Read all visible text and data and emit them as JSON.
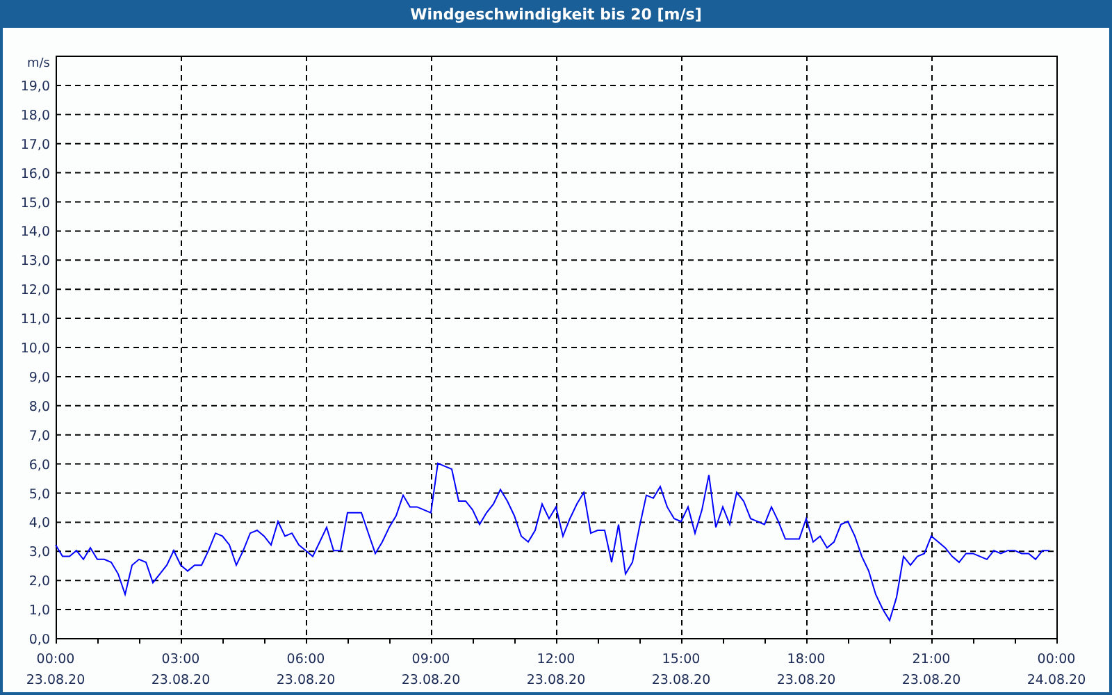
{
  "window": {
    "title": "Windgeschwindigkeit bis 20 [m/s]"
  },
  "chart_data": {
    "type": "line",
    "grid": true,
    "ylabel": "m/s",
    "ylim": [
      0,
      20
    ],
    "categories": [
      "00:00\n23.08.20",
      null,
      null,
      null,
      null,
      null,
      null,
      null,
      null,
      null,
      null,
      null,
      null,
      null,
      null,
      null,
      null,
      null,
      "03:00\n23.08.20",
      null,
      null,
      null,
      null,
      null,
      null,
      null,
      null,
      null,
      null,
      null,
      null,
      null,
      null,
      null,
      null,
      null,
      "06:00\n23.08.20",
      null,
      null,
      null,
      null,
      null,
      null,
      null,
      null,
      null,
      null,
      null,
      null,
      null,
      null,
      null,
      null,
      null,
      "09:00\n23.08.20",
      null,
      null,
      null,
      null,
      null,
      null,
      null,
      null,
      null,
      null,
      null,
      null,
      null,
      null,
      null,
      null,
      null,
      "12:00\n23.08.20",
      null,
      null,
      null,
      null,
      null,
      null,
      null,
      null,
      null,
      null,
      null,
      null,
      null,
      null,
      null,
      null,
      null,
      "15:00\n23.08.20",
      null,
      null,
      null,
      null,
      null,
      null,
      null,
      null,
      null,
      null,
      null,
      null,
      null,
      null,
      null,
      null,
      null,
      "18:00\n23.08.20",
      null,
      null,
      null,
      null,
      null,
      null,
      null,
      null,
      null,
      null,
      null,
      null,
      null,
      null,
      null,
      null,
      null,
      "21:00\n23.08.20",
      null,
      null,
      null,
      null,
      null,
      null,
      null,
      null,
      null,
      null,
      null,
      null,
      null,
      null,
      null,
      null,
      null,
      "00:00\n24.08.20"
    ],
    "series": [
      {
        "color": "#0000ff",
        "values": [
          3.2,
          2.8,
          2.8,
          3.0,
          2.7,
          3.1,
          2.7,
          2.7,
          2.6,
          2.2,
          1.5,
          2.5,
          2.7,
          2.6,
          1.9,
          2.2,
          2.5,
          3.0,
          2.5,
          2.3,
          2.5,
          2.5,
          3.0,
          3.6,
          3.5,
          3.2,
          2.5,
          3.0,
          3.6,
          3.7,
          3.5,
          3.2,
          4.0,
          3.5,
          3.6,
          3.2,
          3.0,
          2.8,
          3.3,
          3.8,
          3.0,
          3.0,
          4.3,
          4.3,
          4.3,
          3.6,
          2.9,
          3.3,
          3.8,
          4.2,
          4.9,
          4.5,
          4.5,
          4.4,
          4.3,
          6.0,
          5.9,
          5.8,
          4.7,
          4.7,
          4.4,
          3.9,
          4.3,
          4.6,
          5.1,
          4.7,
          4.2,
          3.5,
          3.3,
          3.7,
          4.6,
          4.1,
          4.5,
          3.5,
          4.1,
          4.6,
          5.0,
          3.6,
          3.7,
          3.7,
          2.6,
          3.9,
          2.2,
          2.6,
          3.8,
          4.9,
          4.8,
          5.2,
          4.5,
          4.1,
          4.0,
          4.5,
          3.6,
          4.4,
          5.6,
          3.8,
          4.5,
          3.9,
          5.0,
          4.7,
          4.1,
          4.0,
          3.9,
          4.5,
          4.0,
          3.4,
          3.4,
          3.4,
          4.1,
          3.3,
          3.5,
          3.1,
          3.3,
          3.9,
          4.0,
          3.5,
          2.8,
          2.3,
          1.5,
          1.0,
          0.6,
          1.4,
          2.8,
          2.5,
          2.8,
          2.9,
          3.5,
          3.3,
          3.1,
          2.8,
          2.6,
          2.9,
          2.9,
          2.8,
          2.7,
          3.0,
          2.9,
          3.0,
          3.0,
          2.9,
          2.9,
          2.7,
          3.0,
          3.0,
          null
        ]
      }
    ],
    "yticks": [
      {
        "value": 0,
        "label": "0,0"
      },
      {
        "value": 1,
        "label": "1,0"
      },
      {
        "value": 2,
        "label": "2,0"
      },
      {
        "value": 3,
        "label": "3,0"
      },
      {
        "value": 4,
        "label": "4,0"
      },
      {
        "value": 5,
        "label": "5,0"
      },
      {
        "value": 6,
        "label": "6,0"
      },
      {
        "value": 7,
        "label": "7,0"
      },
      {
        "value": 8,
        "label": "8,0"
      },
      {
        "value": 9,
        "label": "9,0"
      },
      {
        "value": 10,
        "label": "10,0"
      },
      {
        "value": 11,
        "label": "11,0"
      },
      {
        "value": 12,
        "label": "12,0"
      },
      {
        "value": 13,
        "label": "13,0"
      },
      {
        "value": 14,
        "label": "14,0"
      },
      {
        "value": 15,
        "label": "15,0"
      },
      {
        "value": 16,
        "label": "16,0"
      },
      {
        "value": 17,
        "label": "17,0"
      },
      {
        "value": 18,
        "label": "18,0"
      },
      {
        "value": 19,
        "label": "19,0"
      }
    ]
  }
}
